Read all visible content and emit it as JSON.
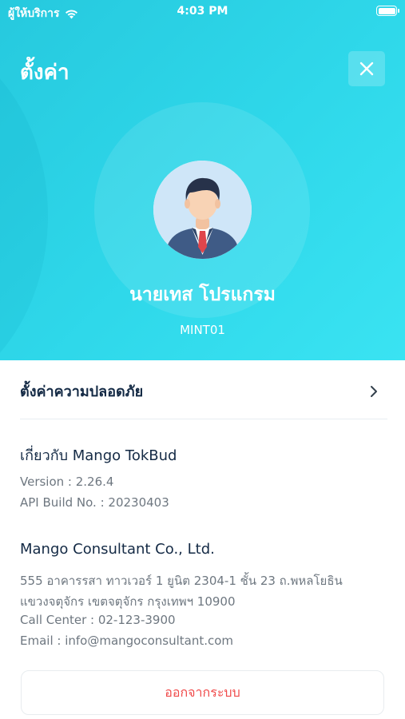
{
  "status_bar": {
    "carrier": "ผู้ให้บริการ",
    "time": "4:03 PM"
  },
  "header": {
    "title": "ตั้งค่า",
    "close_icon": "close-icon"
  },
  "profile": {
    "name": "นายเทส โปรแกรม",
    "code": "MINT01"
  },
  "security": {
    "label": "ตั้งค่าความปลอดภัย"
  },
  "about": {
    "title": "เกี่ยวกับ Mango TokBud",
    "version": "Version : 2.26.4",
    "api_build": "API Build No. : 20230403"
  },
  "company": {
    "name": "Mango Consultant Co., Ltd.",
    "address_line1": "555 อาคารรสา ทาวเวอร์ 1 ยูนิต 2304-1 ชั้น 23 ถ.พหลโยธิน",
    "address_line2": "แขวงจตุจักร เขตจตุจักร กรุงเทพฯ 10900",
    "call_center": "Call Center : 02-123-3900",
    "email": "Email : info@mangoconsultant.com"
  },
  "logout": {
    "label": "ออกจากระบบ"
  },
  "colors": {
    "header_start": "#26c9de",
    "header_end": "#3ae3f2",
    "title_text": "#142a45",
    "muted_text": "#6e7780",
    "danger": "#f04a4a"
  }
}
